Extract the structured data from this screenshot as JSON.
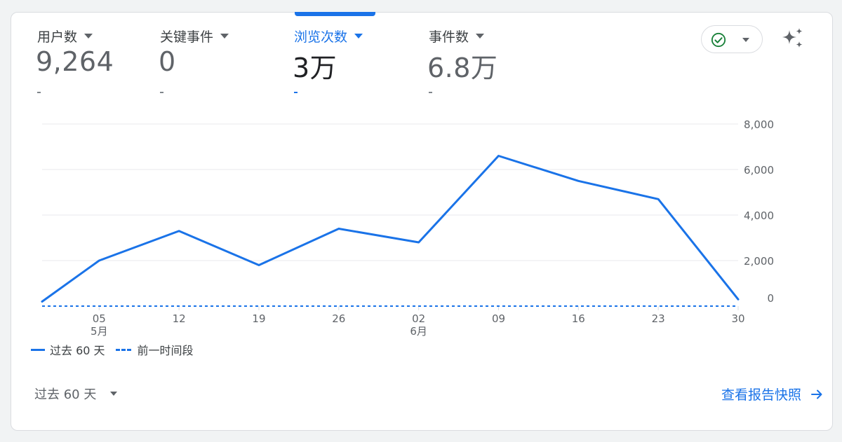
{
  "metrics": [
    {
      "label": "用户数",
      "value": "9,264",
      "change": "-",
      "selected": false
    },
    {
      "label": "关键事件",
      "value": "0",
      "change": "-",
      "selected": false
    },
    {
      "label": "浏览次数",
      "value": "3万",
      "change": "-",
      "selected": true
    },
    {
      "label": "事件数",
      "value": "6.8万",
      "change": "-",
      "selected": false
    }
  ],
  "controls": {
    "compare_icon": "check-circle-icon",
    "insights_icon": "sparkle-icon"
  },
  "chart_data": {
    "type": "line",
    "y_ticks": [
      "8,000",
      "6,000",
      "4,000",
      "2,000",
      "0"
    ],
    "ylim": [
      0,
      8000
    ],
    "grid": true,
    "x_ticks": [
      {
        "day": "05",
        "month": "5月"
      },
      {
        "day": "12",
        "month": ""
      },
      {
        "day": "19",
        "month": ""
      },
      {
        "day": "26",
        "month": ""
      },
      {
        "day": "02",
        "month": "6月"
      },
      {
        "day": "09",
        "month": ""
      },
      {
        "day": "16",
        "month": ""
      },
      {
        "day": "23",
        "month": ""
      },
      {
        "day": "30",
        "month": ""
      }
    ],
    "series": [
      {
        "name": "过去 60 天",
        "style": "solid",
        "color": "#1a73e8",
        "x": [
          "2025-04-30",
          "2025-05-05",
          "2025-05-12",
          "2025-05-19",
          "2025-05-26",
          "2025-06-02",
          "2025-06-09",
          "2025-06-16",
          "2025-06-23",
          "2025-06-30"
        ],
        "y": [
          200,
          2000,
          3300,
          1800,
          3400,
          2800,
          6600,
          5500,
          4700,
          300
        ]
      },
      {
        "name": "前一时间段",
        "style": "dashed",
        "color": "#1a73e8",
        "x": [
          "2025-04-30",
          "2025-06-30"
        ],
        "y": [
          0,
          0
        ]
      }
    ],
    "legend_position": "bottom-left"
  },
  "legend": {
    "current": "过去 60 天",
    "previous": "前一时间段"
  },
  "footer": {
    "date_range": "过去 60 天",
    "report_link": "查看报告快照"
  }
}
